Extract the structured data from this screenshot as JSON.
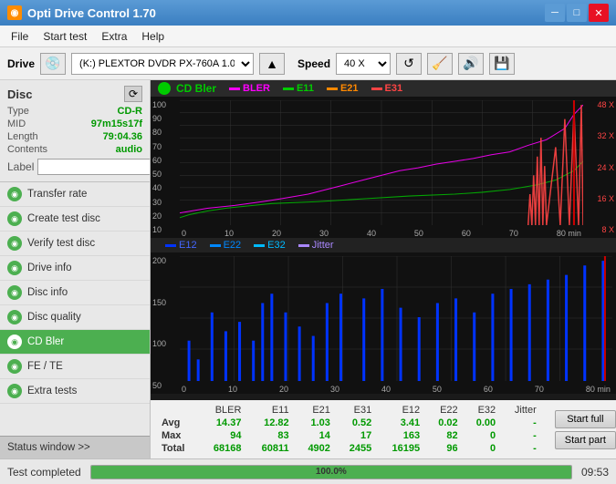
{
  "titlebar": {
    "icon": "◉",
    "title": "Opti Drive Control 1.70",
    "min": "─",
    "max": "□",
    "close": "✕"
  },
  "menubar": {
    "items": [
      "File",
      "Start test",
      "Extra",
      "Help"
    ]
  },
  "drivebar": {
    "drive_label": "Drive",
    "drive_value": "(K:)  PLEXTOR DVDR  PX-760A 1.07",
    "speed_label": "Speed",
    "speed_value": "40 X"
  },
  "disc": {
    "title": "Disc",
    "type_label": "Type",
    "type_value": "CD-R",
    "mid_label": "MID",
    "mid_value": "97m15s17f",
    "length_label": "Length",
    "length_value": "79:04.36",
    "contents_label": "Contents",
    "contents_value": "audio",
    "label_label": "Label",
    "label_value": ""
  },
  "nav": {
    "items": [
      {
        "id": "transfer-rate",
        "label": "Transfer rate",
        "active": false
      },
      {
        "id": "create-test-disc",
        "label": "Create test disc",
        "active": false
      },
      {
        "id": "verify-test-disc",
        "label": "Verify test disc",
        "active": false
      },
      {
        "id": "drive-info",
        "label": "Drive info",
        "active": false
      },
      {
        "id": "disc-info",
        "label": "Disc info",
        "active": false
      },
      {
        "id": "disc-quality",
        "label": "Disc quality",
        "active": false
      },
      {
        "id": "cd-bler",
        "label": "CD Bler",
        "active": true
      },
      {
        "id": "fe-te",
        "label": "FE / TE",
        "active": false
      },
      {
        "id": "extra-tests",
        "label": "Extra tests",
        "active": false
      }
    ]
  },
  "status_window": {
    "label": "Status window >>"
  },
  "chart1": {
    "title": "CD Bler",
    "legend": [
      {
        "id": "BLER",
        "color": "#ff00ff",
        "label": "BLER"
      },
      {
        "id": "E11",
        "color": "#00aa00",
        "label": "E11"
      },
      {
        "id": "E21",
        "color": "#ff6600",
        "label": "E21"
      },
      {
        "id": "E31",
        "color": "#ff0000",
        "label": "E31"
      }
    ],
    "y_max": 100,
    "y_labels": [
      "100",
      "90",
      "80",
      "70",
      "60",
      "50",
      "40",
      "30",
      "20",
      "10"
    ],
    "x_labels": [
      "0",
      "10",
      "20",
      "30",
      "40",
      "50",
      "60",
      "70",
      "80"
    ],
    "right_labels": [
      "48 X",
      "32 X",
      "24 X",
      "16 X",
      "8 X"
    ]
  },
  "chart2": {
    "legend": [
      {
        "id": "E12",
        "color": "#0000ff",
        "label": "E12"
      },
      {
        "id": "E22",
        "color": "#0088ff",
        "label": "E22"
      },
      {
        "id": "E32",
        "color": "#00ccff",
        "label": "E32"
      },
      {
        "id": "Jitter",
        "color": "#aa00aa",
        "label": "Jitter"
      }
    ],
    "y_max": 200,
    "y_labels": [
      "200",
      "150",
      "100",
      "50"
    ],
    "x_labels": [
      "0",
      "10",
      "20",
      "30",
      "40",
      "50",
      "60",
      "70",
      "80"
    ]
  },
  "stats": {
    "headers": [
      "",
      "BLER",
      "E11",
      "E21",
      "E31",
      "E12",
      "E22",
      "E32",
      "Jitter"
    ],
    "rows": [
      {
        "label": "Avg",
        "values": [
          "14.37",
          "12.82",
          "1.03",
          "0.52",
          "3.41",
          "0.02",
          "0.00",
          "-"
        ]
      },
      {
        "label": "Max",
        "values": [
          "94",
          "83",
          "14",
          "17",
          "163",
          "82",
          "0",
          "-"
        ]
      },
      {
        "label": "Total",
        "values": [
          "68168",
          "60811",
          "4902",
          "2455",
          "16195",
          "96",
          "0",
          "-"
        ]
      }
    ]
  },
  "buttons": {
    "start_full": "Start full",
    "start_part": "Start part"
  },
  "statusbar": {
    "text": "Test completed",
    "progress": 100,
    "progress_label": "100.0%",
    "time": "09:53"
  }
}
